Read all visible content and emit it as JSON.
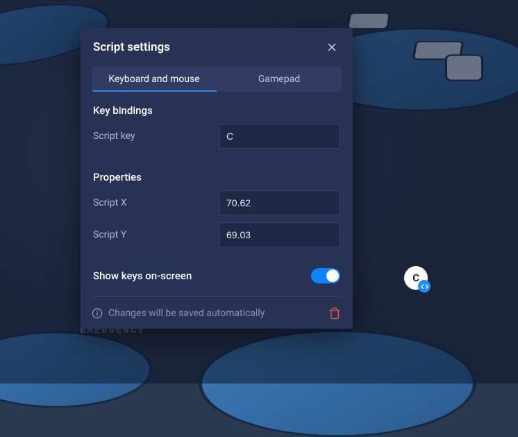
{
  "dialog": {
    "title": "Script settings",
    "tabs": [
      {
        "label": "Keyboard and mouse",
        "active": true
      },
      {
        "label": "Gamepad",
        "active": false
      }
    ],
    "sections": {
      "keybindings": {
        "title": "Key bindings",
        "script_key_label": "Script key",
        "script_key_value": "C"
      },
      "properties": {
        "title": "Properties",
        "script_x_label": "Script X",
        "script_x_value": "70.62",
        "script_y_label": "Script Y",
        "script_y_value": "69.03"
      }
    },
    "toggle": {
      "label": "Show keys on-screen",
      "value": true
    },
    "footer_text": "Changes will be saved automatically"
  },
  "overlay_badge": {
    "letter": "C"
  },
  "background": {
    "emergency_label": "EMERGENCY"
  }
}
